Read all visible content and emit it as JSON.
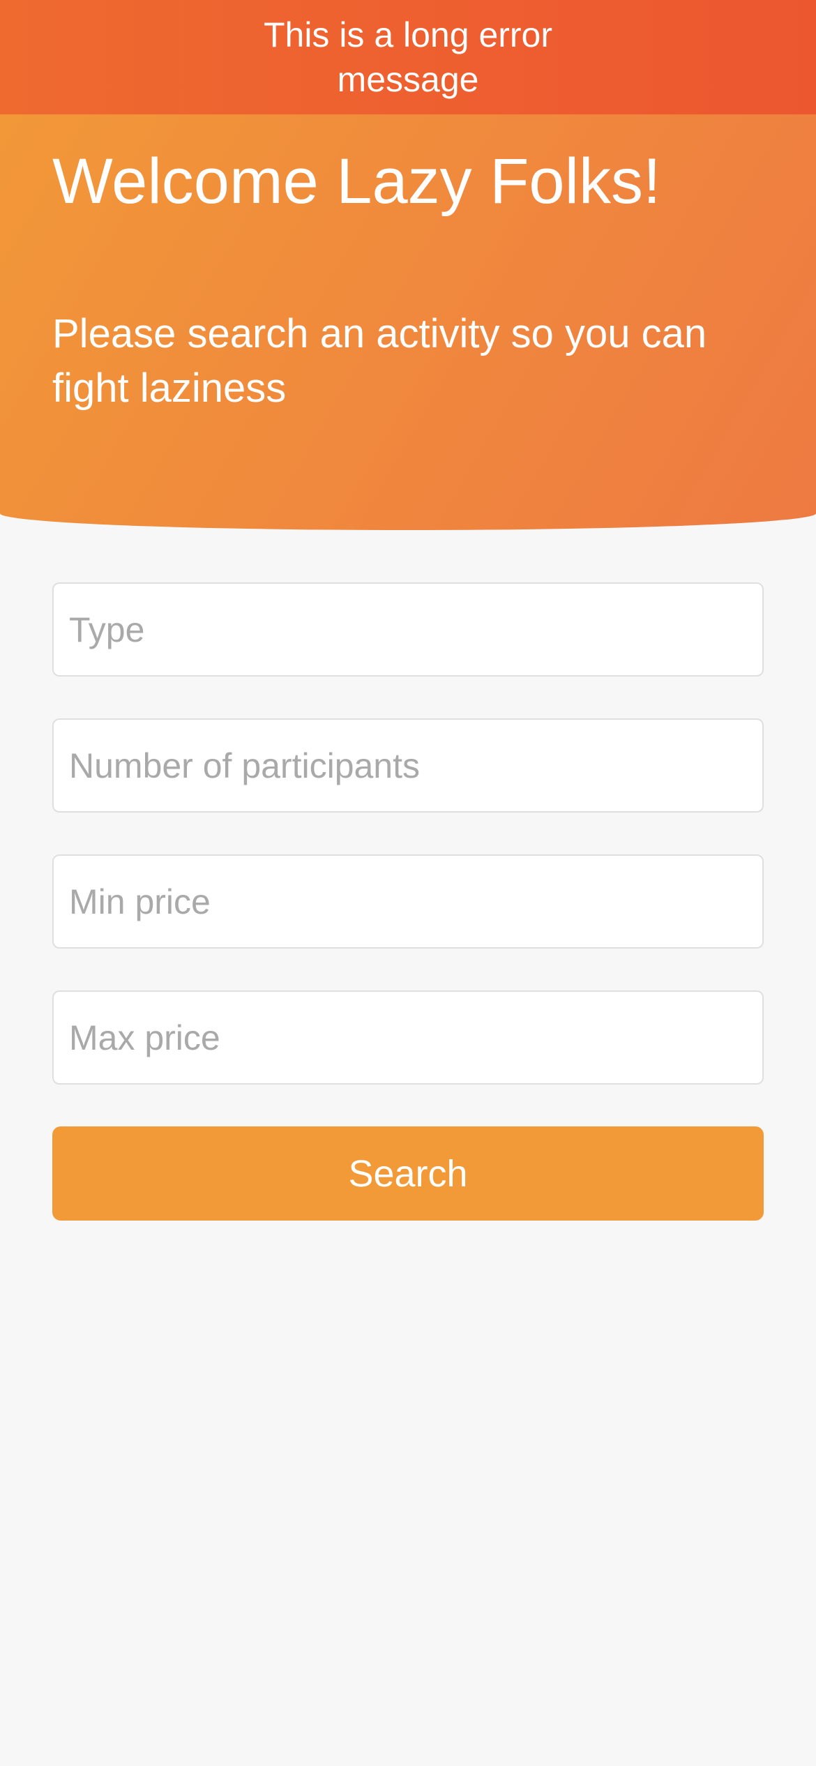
{
  "banner": {
    "error_message": "This is a long error message"
  },
  "hero": {
    "title": "Welcome Lazy Folks!",
    "subtitle": "Please search an activity so you can fight laziness"
  },
  "form": {
    "type_placeholder": "Type",
    "participants_placeholder": "Number of participants",
    "min_price_placeholder": "Min price",
    "max_price_placeholder": "Max price",
    "search_label": "Search"
  },
  "colors": {
    "header_orange": "#f29a38",
    "error_orange": "#ee5f30",
    "button_orange": "#f29a38",
    "background": "#f7f7f7"
  }
}
